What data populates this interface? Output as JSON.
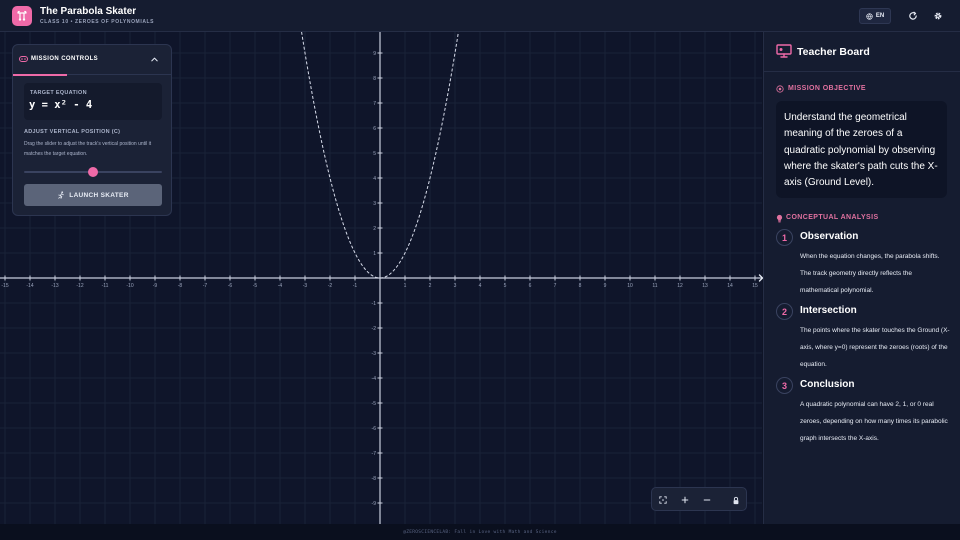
{
  "header": {
    "title": "The Parabola Skater",
    "subtitle": "CLASS 10 • ZEROES OF POLYNOMIALS",
    "lang_label": "EN"
  },
  "mission": {
    "title": "MISSION CONTROLS",
    "equation_label": "TARGET EQUATION",
    "equation": "y = x² - 4",
    "adjust_label": "ADJUST VERTICAL POSITION (C)",
    "adjust_desc": "Drag the slider to adjust the track's vertical position until it matches the target equation.",
    "slider_value_fraction": 0.5,
    "launch_label": "LAUNCH SKATER"
  },
  "graph": {
    "x_ticks": [
      "-15",
      "-14",
      "-13",
      "-12",
      "-11",
      "-10",
      "-9",
      "-8",
      "-7",
      "-6",
      "-5",
      "-4",
      "-3",
      "-2",
      "-1",
      "1",
      "2",
      "3",
      "4",
      "5",
      "6",
      "7",
      "8",
      "9",
      "10",
      "11",
      "12",
      "13",
      "14",
      "15"
    ],
    "y_ticks": [
      "9",
      "8",
      "7",
      "6",
      "5",
      "4",
      "3",
      "2",
      "1",
      "-1",
      "-2",
      "-3",
      "-4",
      "-5",
      "-6",
      "-7",
      "-8",
      "-9"
    ],
    "x_range": [
      -15,
      15
    ],
    "y_range": [
      -9,
      9
    ],
    "track_vertical_shift_c": 0,
    "grid": true
  },
  "board": {
    "title": "Teacher Board",
    "objective_label": "MISSION OBJECTIVE",
    "objective_text": "Understand the geometrical meaning of the zeroes of a quadratic polynomial by observing where the skater's path cuts the X-axis (Ground Level).",
    "analysis_label": "CONCEPTUAL ANALYSIS",
    "steps": [
      {
        "num": "1",
        "title": "Observation",
        "text": "When the equation changes, the parabola shifts. The track geometry directly reflects the mathematical polynomial."
      },
      {
        "num": "2",
        "title": "Intersection",
        "text": "The points where the skater touches the Ground (X-axis, where y=0) represent the zeroes (roots) of the equation."
      },
      {
        "num": "3",
        "title": "Conclusion",
        "text": "A quadratic polynomial can have 2, 1, or 0 real zeroes, depending on how many times its parabolic graph intersects the X-axis."
      }
    ]
  },
  "footer": {
    "text": "@ZEROSCIENCELAB: Fall in Love with Math and Science"
  },
  "colors": {
    "accent": "#ef6aa8",
    "background": "#0e1426",
    "panel": "#151c30"
  }
}
